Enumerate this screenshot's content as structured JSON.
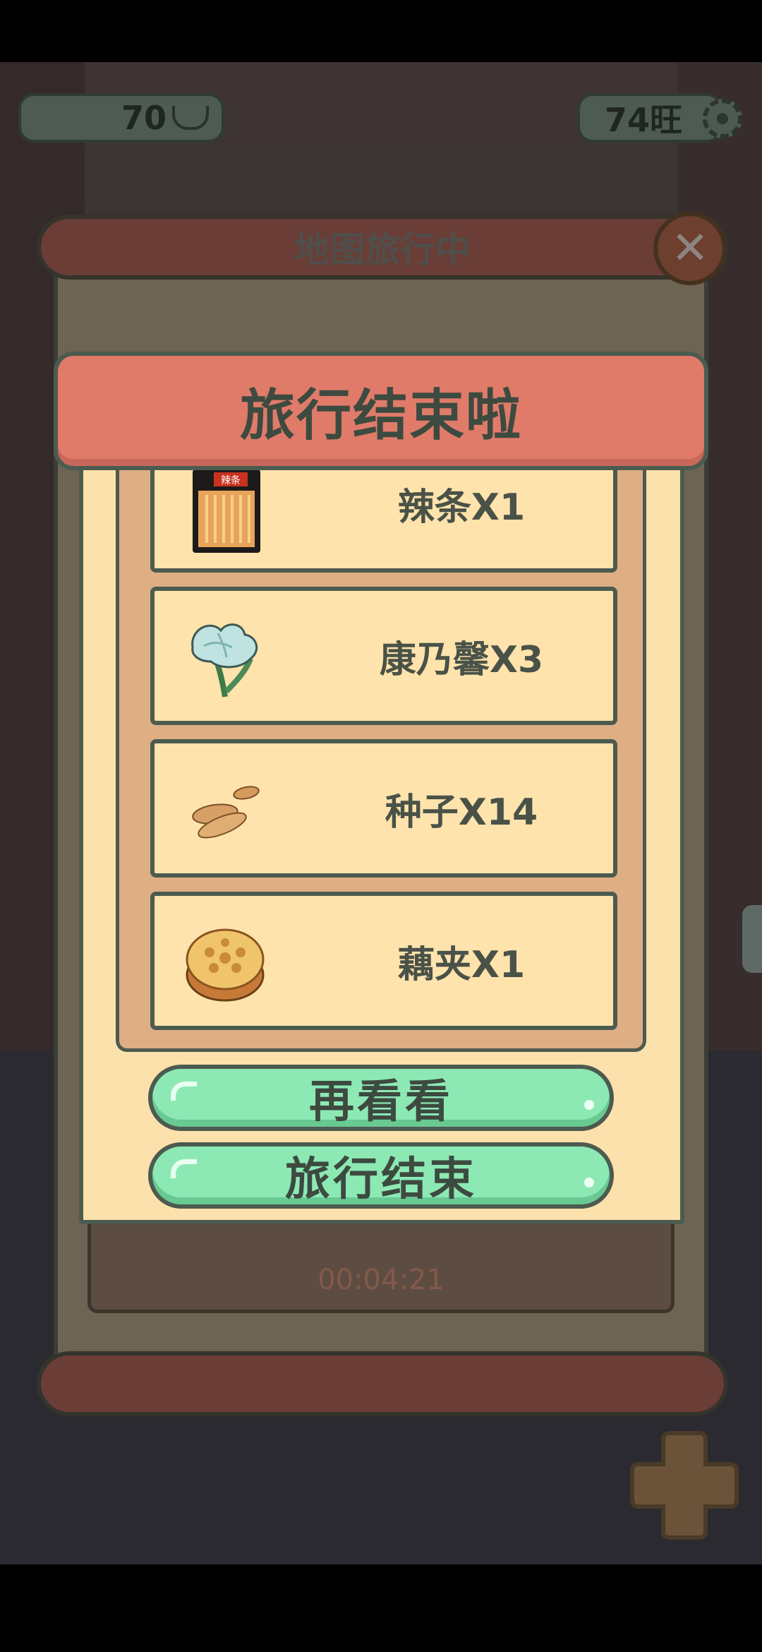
{
  "hud": {
    "coins": "70",
    "coin_icon": "ingot-icon",
    "wang": "74旺",
    "settings_icon": "gear-icon"
  },
  "background_dialog": {
    "title": "地图旅行中",
    "close_icon": "close-icon",
    "timer": "00:04:21"
  },
  "result_dialog": {
    "title": "旅行结束啦",
    "rewards": [
      {
        "label": "辣条X1",
        "icon": "spicy-strip-icon",
        "package_text": "辣条"
      },
      {
        "label": "康乃馨X3",
        "icon": "carnation-icon"
      },
      {
        "label": "种子X14",
        "icon": "seeds-icon"
      },
      {
        "label": "藕夹X1",
        "icon": "lotus-root-sandwich-icon"
      }
    ],
    "buttons": {
      "look_again": "再看看",
      "end_travel": "旅行结束"
    }
  },
  "colors": {
    "banner": "#e07b6a",
    "panel": "#fde1ac",
    "button": "#8de9b4",
    "outline": "#4c5b4f"
  }
}
